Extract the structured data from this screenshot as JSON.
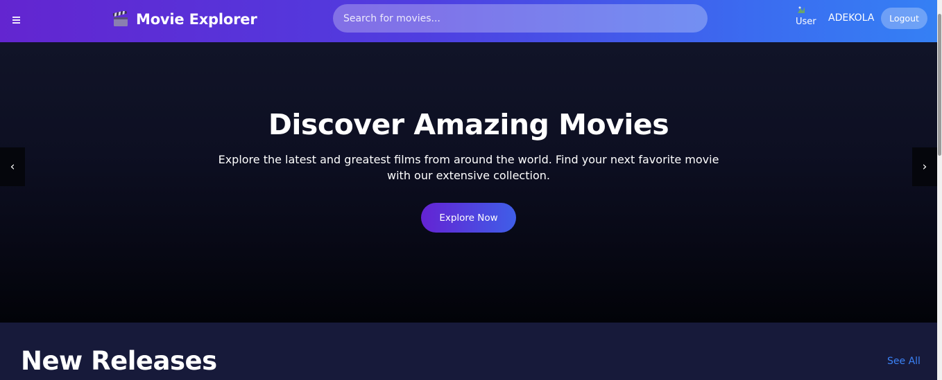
{
  "header": {
    "menu_icon": "hamburger-icon",
    "brand_icon": "clapperboard-icon",
    "brand_title": "Movie Explorer",
    "search_placeholder": "Search for movies...",
    "user_image_alt": "User",
    "username": "ADEKOLA",
    "logout_label": "Logout"
  },
  "hero": {
    "title": "Discover Amazing Movies",
    "subtitle": "Explore the latest and greatest films from around the world. Find your next favorite movie with our extensive collection.",
    "cta_label": "Explore Now",
    "prev_arrow": "‹",
    "next_arrow": "›"
  },
  "new_releases": {
    "title": "New Releases",
    "see_all_label": "See All"
  },
  "colors": {
    "header_gradient_start": "#6325d0",
    "header_gradient_end": "#3580f4",
    "link_blue": "#3b82f6",
    "section_bg": "#171a3a"
  }
}
